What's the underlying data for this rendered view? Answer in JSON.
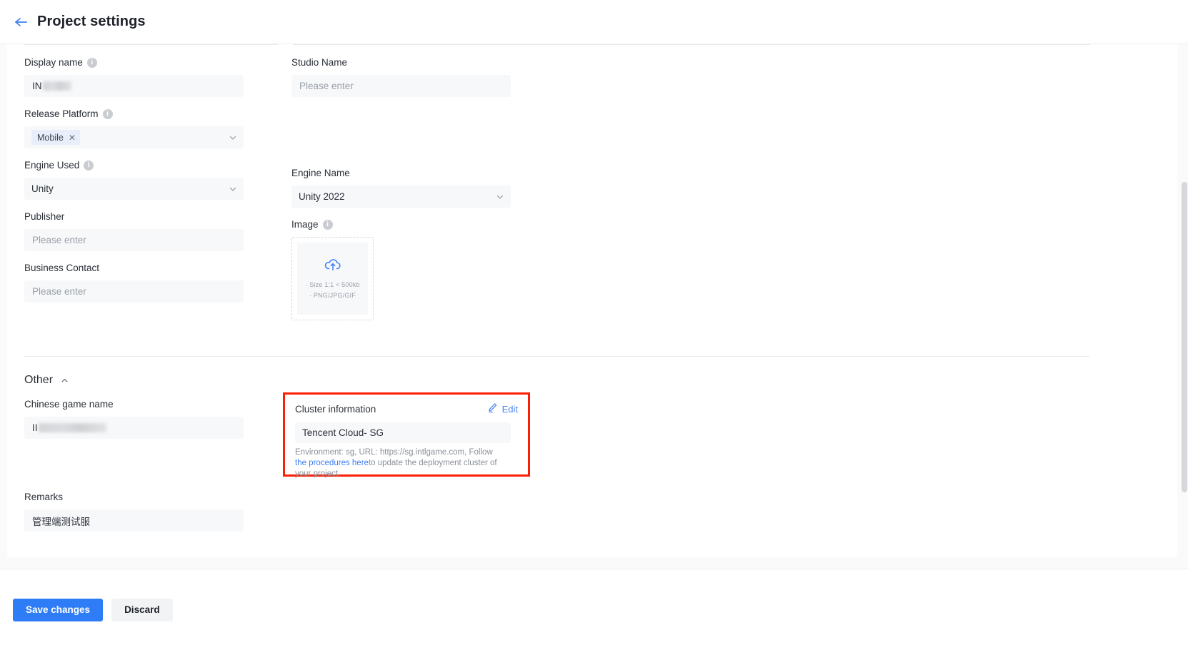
{
  "header": {
    "title": "Project settings",
    "back_icon": "arrow-left-icon"
  },
  "form": {
    "left": [
      {
        "label": "Display name",
        "has_info": true,
        "type": "text",
        "value": "IN",
        "redacted": true,
        "redact_width": 40
      },
      {
        "label": "Release Platform",
        "has_info": true,
        "type": "tag-select",
        "tag": "Mobile",
        "remove_icon": "close-icon",
        "chevron": "chevron-down-icon"
      },
      {
        "label": "Engine Used",
        "has_info": true,
        "type": "select",
        "value": "Unity",
        "chevron": "chevron-down-icon"
      },
      {
        "label": "Publisher",
        "has_info": false,
        "type": "text",
        "value": "",
        "placeholder": "Please enter"
      },
      {
        "label": "Business Contact",
        "has_info": false,
        "type": "text",
        "value": "",
        "placeholder": "Please enter"
      }
    ],
    "right": [
      {
        "label": "Studio Name",
        "has_info": false,
        "type": "text",
        "value": "",
        "placeholder": "Please enter"
      },
      {
        "label": "Engine Name",
        "has_info": false,
        "type": "select",
        "value": "Unity 2022",
        "chevron": "chevron-down-icon"
      },
      {
        "label": "Image",
        "has_info": true,
        "type": "upload",
        "upload_icon": "cloud-upload-icon",
        "hint_line_1": "· Size 1:1 < 500kb",
        "hint_line_2": "· PNG/JPG/GIF"
      }
    ]
  },
  "other_section": {
    "title": "Other",
    "collapse_icon": "chevron-up-icon",
    "chinese_game_name": {
      "label": "Chinese game name",
      "value": "II",
      "redacted": true,
      "redact_width": 95
    },
    "remarks": {
      "label": "Remarks",
      "value": "管理端测试服"
    }
  },
  "cluster": {
    "label": "Cluster information",
    "edit_label": "Edit",
    "edit_icon": "pencil-icon",
    "value": "Tencent Cloud- SG",
    "description_part_1": "Environment: sg, URL: https://sg.intlgame.com, Follow ",
    "description_link": "the procedures here",
    "description_part_2": "to update the deployment cluster of your project.",
    "highlight_color": "#fc1d05"
  },
  "footer": {
    "save_label": "Save changes",
    "discard_label": "Discard",
    "primary_color": "#2f7df6"
  }
}
